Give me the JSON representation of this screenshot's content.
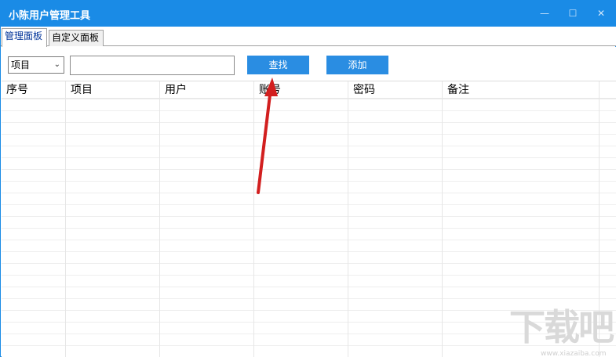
{
  "window": {
    "title": "小陈用户管理工具",
    "minimize_glyph": "—",
    "maximize_glyph": "☐",
    "close_glyph": "✕"
  },
  "tabs": [
    {
      "label": "管理面板",
      "active": true
    },
    {
      "label": "自定义面板",
      "active": false
    }
  ],
  "toolbar": {
    "select_value": "项目",
    "select_chevron": "⌄",
    "search_value": "",
    "find_label": "查找",
    "add_label": "添加"
  },
  "table": {
    "columns": [
      "序号",
      "项目",
      "用户",
      "账号",
      "密码",
      "备注"
    ],
    "rows": []
  },
  "watermark": {
    "text": "下载吧",
    "sub": "www.xiazaiba.com"
  },
  "colors": {
    "titlebar": "#1a8be6",
    "button": "#2a8de2",
    "annotation_arrow": "#d21f1f"
  }
}
